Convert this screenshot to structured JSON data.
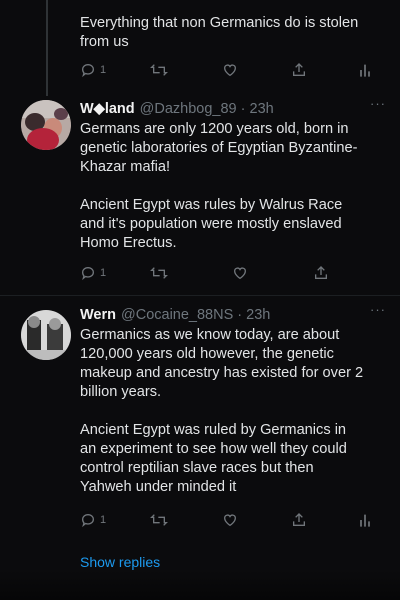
{
  "top_tweet": {
    "text_lines": [
      "Everything that non Germanics do is stolen",
      "from us"
    ],
    "stats": {
      "replies": "1",
      "retweets": "",
      "likes": ""
    }
  },
  "tweet_wieland": {
    "name": "W◆land",
    "handle": "@Dazhbog_89",
    "time": "23h",
    "more": "···",
    "para1": [
      "Germans are only 1200 years old, born in",
      "genetic laboratories of Egyptian Byzantine-",
      "Khazar mafia!"
    ],
    "para2": [
      "Ancient Egypt was rules by Walrus Race",
      "and it's population were mostly enslaved",
      "Homo Erectus."
    ],
    "stats": {
      "replies": "1",
      "retweets": "",
      "likes": ""
    }
  },
  "tweet_wern": {
    "name": "Wern",
    "handle": "@Cocaine_88NS",
    "time": "23h",
    "more": "···",
    "para1": [
      "Germanics as we know today, are about",
      "120,000 years old however, the genetic",
      "makeup and ancestry has existed for over 2",
      "billion years."
    ],
    "para2": [
      "Ancient Egypt was ruled by Germanics in",
      "an experiment to see how well they could",
      "control reptilian slave races but then",
      "Yahweh under minded it"
    ],
    "stats": {
      "replies": "1",
      "retweets": "",
      "likes": ""
    }
  },
  "show_replies_label": "Show replies",
  "icons": [
    "reply-icon",
    "retweet-icon",
    "like-icon",
    "share-icon",
    "analytics-icon"
  ],
  "colors": {
    "background": "#0b0b0d",
    "text": "#e7e9ea",
    "muted": "#71767b",
    "link": "#1d9bf0"
  }
}
